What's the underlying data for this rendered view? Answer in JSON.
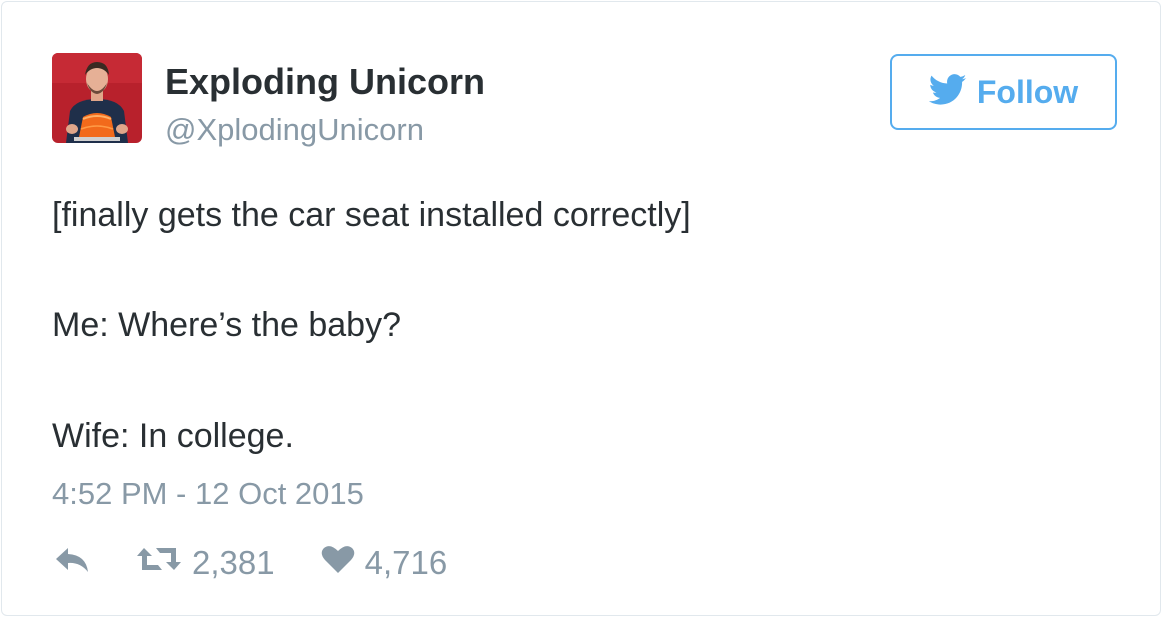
{
  "user": {
    "display_name": "Exploding Unicorn",
    "handle": "@XplodingUnicorn"
  },
  "follow_button": {
    "label": "Follow",
    "icon": "twitter-bird-icon"
  },
  "tweet": {
    "lines": [
      "[finally gets the car seat installed correctly]",
      "Me: Where’s the baby?",
      "Wife: In college."
    ],
    "timestamp": "4:52 PM - 12 Oct 2015"
  },
  "actions": {
    "reply_icon": "reply-icon",
    "retweet_icon": "retweet-icon",
    "retweet_count": "2,381",
    "like_icon": "heart-icon",
    "like_count": "4,716"
  },
  "colors": {
    "accent": "#55acee",
    "text": "#292f33",
    "muted": "#8899a6",
    "border": "#e1e8ed"
  }
}
